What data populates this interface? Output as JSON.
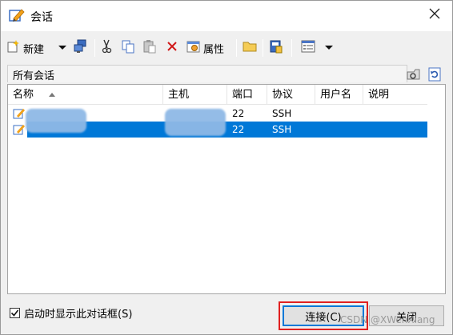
{
  "window": {
    "title": "会话",
    "close_icon": "close-icon"
  },
  "toolbar": {
    "new_label": "新建",
    "properties_label": "属性",
    "icons": [
      "new-session-icon",
      "dropdown-arrow-icon",
      "network-computer-icon",
      "cut-icon",
      "copy-icon",
      "paste-icon",
      "delete-icon",
      "properties-icon",
      "folder-icon",
      "script-icon",
      "view-icon",
      "dropdown-arrow-icon"
    ]
  },
  "sessions_header": {
    "label": "所有会话"
  },
  "list": {
    "columns": [
      "名称",
      "主机",
      "端口",
      "协议",
      "用户名",
      "说明"
    ],
    "rows": [
      {
        "name": "",
        "host": "",
        "port": "22",
        "protocol": "SSH",
        "user": "",
        "note": "",
        "selected": false
      },
      {
        "name": "",
        "host": "",
        "port": "22",
        "protocol": "SSH",
        "user": "",
        "note": "",
        "selected": true
      }
    ]
  },
  "footer": {
    "startup_label": "启动时显示此对话框(S)",
    "startup_checked": true,
    "connect_label": "连接(C)",
    "close_label": "关闭",
    "watermark": "CSDN @XWenXiang"
  },
  "colors": {
    "selection": "#0078d7",
    "highlight_box": "#e02020"
  }
}
